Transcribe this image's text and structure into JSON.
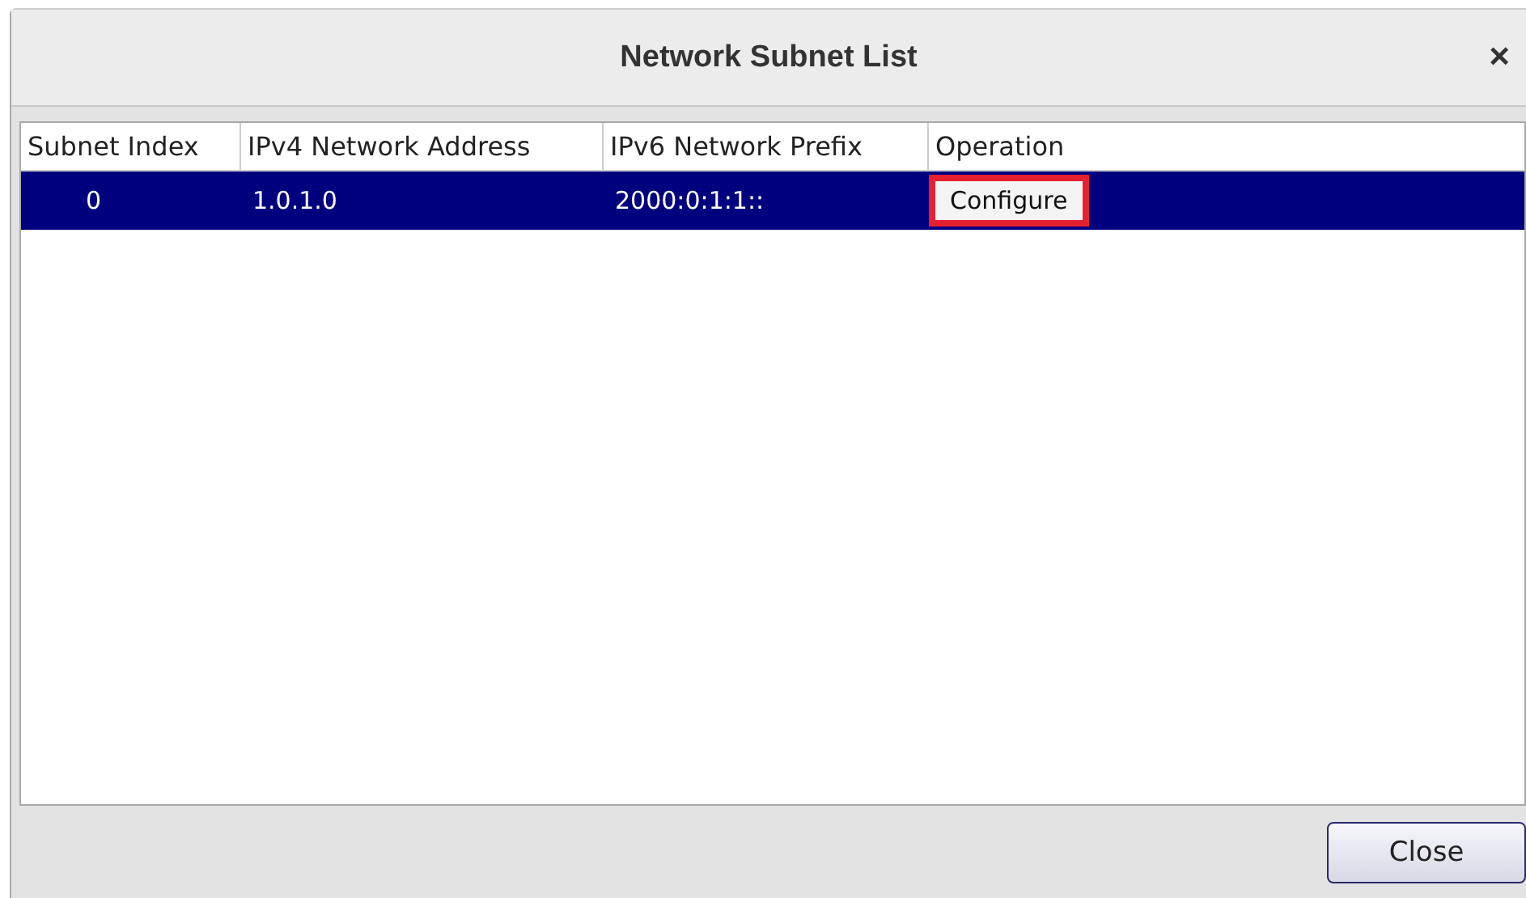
{
  "window": {
    "title": "Network Subnet List",
    "close_icon": "×"
  },
  "table": {
    "columns": [
      "Subnet Index",
      "IPv4 Network Address",
      "IPv6 Network Prefix",
      "Operation"
    ],
    "rows": [
      {
        "selected": true,
        "index": "0",
        "ipv4": "1.0.1.0",
        "ipv6": "2000:0:1:1::",
        "operation": {
          "label": "Configure",
          "highlighted": true
        }
      }
    ]
  },
  "buttons": [
    {
      "label": "Close"
    }
  ]
}
